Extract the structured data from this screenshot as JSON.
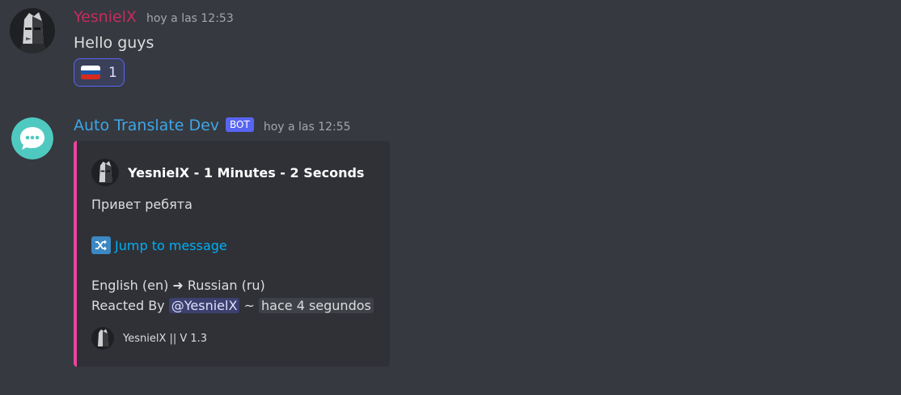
{
  "colors": {
    "background": "#36393f",
    "user1_name": "#c62b5f",
    "bot_name": "#3ea6e8",
    "bot_tag": "#5865f2",
    "embed_accent": "#eb459e",
    "link": "#00aff4"
  },
  "messages": [
    {
      "username": "YesnielX",
      "timestamp": "hoy a las 12:53",
      "text": "Hello guys",
      "avatar_icon": "masked-character-avatar",
      "reaction": {
        "emoji": "russian-flag-icon",
        "count": "1"
      }
    },
    {
      "username": "Auto Translate Dev",
      "bot_tag": "BOT",
      "timestamp": "hoy a las 12:55",
      "avatar_icon": "chat-bubble-icon",
      "embed": {
        "author": "YesnielX - 1 Minutes - 2 Seconds",
        "translated_text": "Привет ребята",
        "jump_icon": "shuffle-icon",
        "jump_text": "Jump to message",
        "languages": "English (en) ➜ Russian (ru)",
        "reacted_by_label": "Reacted By",
        "mention": "@YesnielX",
        "separator": "~",
        "relative_time": "hace 4 segundos",
        "footer": "YesnielX || V 1.3"
      }
    }
  ]
}
